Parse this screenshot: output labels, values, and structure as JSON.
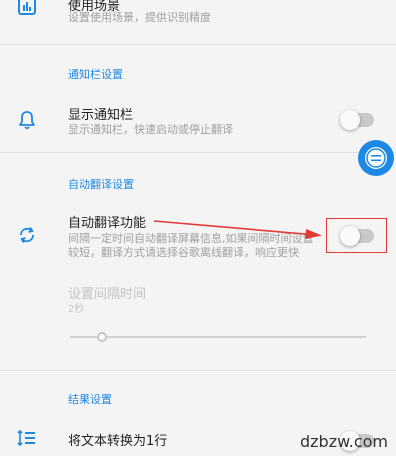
{
  "scene_section": {
    "title": "使用场景",
    "summary": "设置使用场景，提供识别精度",
    "icon": "bar-chart-icon"
  },
  "notification_section": {
    "header": "通知栏设置",
    "item": {
      "title": "显示通知栏",
      "summary": "显示通知栏，快速启动或停止翻译",
      "icon": "bell-icon",
      "enabled": false
    }
  },
  "auto_translate_section": {
    "header": "自动翻译设置",
    "item": {
      "title": "自动翻译功能",
      "summary_line1": "间隔一定时间自动翻译屏幕信息,如果间隔时间设置",
      "summary_line2": "较短，翻译方式请选择谷歌离线翻译，响应更快",
      "icon": "sync-icon",
      "enabled": false
    },
    "interval": {
      "title": "设置间隔时间",
      "value": "2秒",
      "slider_fraction": 0.1
    }
  },
  "result_section": {
    "header": "结果设置",
    "item": {
      "title": "将文本转换为1行",
      "icon": "text-lines-icon",
      "enabled": false
    }
  },
  "colors": {
    "accent": "#1e88e5",
    "annotation": "#e53935"
  },
  "watermark": "dzbzw.com"
}
